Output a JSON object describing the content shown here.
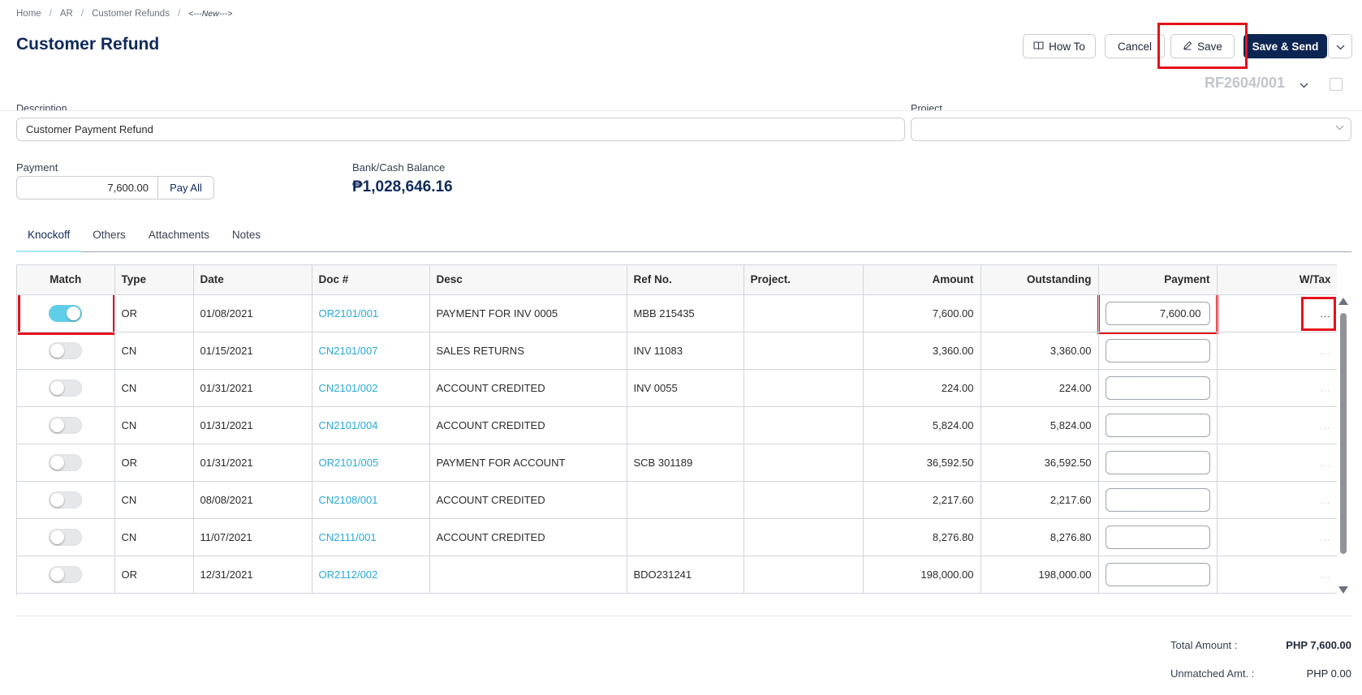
{
  "breadcrumb": {
    "home": "Home",
    "ar": "AR",
    "refunds": "Customer Refunds",
    "current": "<---New--->"
  },
  "page_title": "Customer Refund",
  "toolbar": {
    "howto": "How To",
    "cancel": "Cancel",
    "save": "Save",
    "send": "Save & Send"
  },
  "doc_number": "RF2604/001",
  "form": {
    "description_label": "Description",
    "description_value": "Customer Payment Refund",
    "project_label": "Project",
    "project_value": "",
    "payment_label": "Payment",
    "payment_value": "7,600.00",
    "pay_all": "Pay All",
    "balance_label": "Bank/Cash Balance",
    "balance_value": "₱1,028,646.16"
  },
  "tabs": [
    "Knockoff",
    "Others",
    "Attachments",
    "Notes"
  ],
  "table": {
    "columns": [
      "Match",
      "Type",
      "Date",
      "Doc #",
      "Desc",
      "Ref No.",
      "Project.",
      "Amount",
      "Outstanding",
      "Payment",
      "W/Tax"
    ],
    "rows": [
      {
        "match": true,
        "type": "OR",
        "date": "01/08/2021",
        "doc": "OR2101/001",
        "desc": "PAYMENT FOR INV 0005",
        "ref": "MBB 215435",
        "project": "",
        "amount": "7,600.00",
        "outstanding": "",
        "payment": "7,600.00",
        "wtax": "..."
      },
      {
        "match": false,
        "type": "CN",
        "date": "01/15/2021",
        "doc": "CN2101/007",
        "desc": "SALES RETURNS",
        "ref": "INV 11083",
        "project": "",
        "amount": "3,360.00",
        "outstanding": "3,360.00",
        "payment": "",
        "wtax": "..."
      },
      {
        "match": false,
        "type": "CN",
        "date": "01/31/2021",
        "doc": "CN2101/002",
        "desc": "ACCOUNT CREDITED",
        "ref": "INV 0055",
        "project": "",
        "amount": "224.00",
        "outstanding": "224.00",
        "payment": "",
        "wtax": "..."
      },
      {
        "match": false,
        "type": "CN",
        "date": "01/31/2021",
        "doc": "CN2101/004",
        "desc": "ACCOUNT CREDITED",
        "ref": "",
        "project": "",
        "amount": "5,824.00",
        "outstanding": "5,824.00",
        "payment": "",
        "wtax": "..."
      },
      {
        "match": false,
        "type": "OR",
        "date": "01/31/2021",
        "doc": "OR2101/005",
        "desc": "PAYMENT FOR ACCOUNT",
        "ref": "SCB 301189",
        "project": "",
        "amount": "36,592.50",
        "outstanding": "36,592.50",
        "payment": "",
        "wtax": "..."
      },
      {
        "match": false,
        "type": "CN",
        "date": "08/08/2021",
        "doc": "CN2108/001",
        "desc": "ACCOUNT CREDITED",
        "ref": "",
        "project": "",
        "amount": "2,217.60",
        "outstanding": "2,217.60",
        "payment": "",
        "wtax": "..."
      },
      {
        "match": false,
        "type": "CN",
        "date": "11/07/2021",
        "doc": "CN2111/001",
        "desc": "ACCOUNT CREDITED",
        "ref": "",
        "project": "",
        "amount": "8,276.80",
        "outstanding": "8,276.80",
        "payment": "",
        "wtax": "..."
      },
      {
        "match": false,
        "type": "OR",
        "date": "12/31/2021",
        "doc": "OR2112/002",
        "desc": "",
        "ref": "BDO231241",
        "project": "",
        "amount": "198,000.00",
        "outstanding": "198,000.00",
        "payment": "",
        "wtax": "..."
      }
    ]
  },
  "totals": {
    "total_label": "Total Amount :",
    "total_value": "PHP 7,600.00",
    "unmatched_label": "Unmatched Amt. :",
    "unmatched_value": "PHP 0.00"
  },
  "colors": {
    "brand": "#0f2a5a",
    "link": "#29a8d8",
    "toggle_on": "#5fcfe9",
    "highlight": "#e5121b"
  },
  "icons": [
    "book-icon",
    "pencil-icon",
    "chevron-down-icon",
    "document-search-icon",
    "scroll-up-icon",
    "scroll-down-icon"
  ]
}
